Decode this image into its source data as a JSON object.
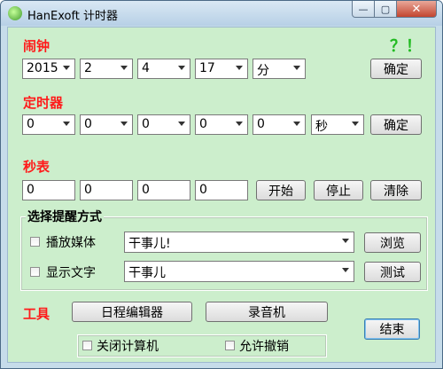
{
  "window": {
    "title": "HanExoft 计时器",
    "minimize_glyph": "—",
    "maximize_glyph": "▢",
    "close_glyph": "✕"
  },
  "alarm": {
    "label": "闹钟",
    "help": "？！",
    "selects": [
      "2015",
      "2",
      "4",
      "17",
      "分"
    ],
    "confirm_label": "确定"
  },
  "timer": {
    "label": "定时器",
    "selects": [
      "0",
      "0",
      "0",
      "0",
      "0",
      "秒"
    ],
    "confirm_label": "确定"
  },
  "stopwatch": {
    "label": "秒表",
    "fields": [
      "0",
      "0",
      "0",
      "0"
    ],
    "start_label": "开始",
    "stop_label": "停止",
    "clear_label": "清除"
  },
  "reminder": {
    "title": "选择提醒方式",
    "play_media_label": "播放媒体",
    "play_media_value": "干事儿!",
    "browse_label": "浏览",
    "show_text_label": "显示文字",
    "show_text_value": "干事儿",
    "test_label": "测试"
  },
  "tools": {
    "label": "工具",
    "schedule_editor_label": "日程编辑器",
    "recorder_label": "录音机",
    "end_label": "结束",
    "shutdown_label": "关闭计算机",
    "allow_cancel_label": "允许撤销"
  },
  "colors": {
    "accent_red": "#ff1a1a",
    "help_green": "#22bb22",
    "client_bg": "#cceecc"
  }
}
